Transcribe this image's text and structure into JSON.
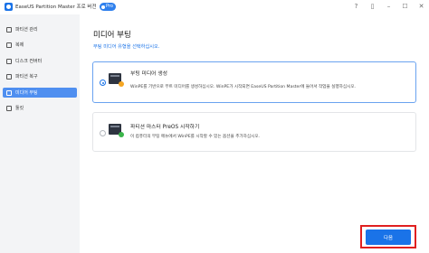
{
  "window": {
    "title": "EaseUS Partition Master 프로 버전",
    "badge": "Pro",
    "controls": [
      "help-icon",
      "bookmark-icon",
      "minimize-icon",
      "maximize-icon",
      "close-icon"
    ]
  },
  "sidebar": {
    "items": [
      {
        "label": "파티션 관리",
        "icon": "partition-icon",
        "active": false
      },
      {
        "label": "복제",
        "icon": "clone-icon",
        "active": false
      },
      {
        "label": "디스크 컨버터",
        "icon": "disk-convert-icon",
        "active": false
      },
      {
        "label": "파티션 복구",
        "icon": "recovery-icon",
        "active": false
      },
      {
        "label": "미디어 부팅",
        "icon": "boot-media-icon",
        "active": true
      },
      {
        "label": "툴킷",
        "icon": "toolkit-icon",
        "active": false
      }
    ]
  },
  "main": {
    "title": "미디어 부팅",
    "subtitle": "부팅 미디어 유형을 선택하십시오.",
    "options": [
      {
        "title": "부팅 미디어 생성",
        "description": "WinPE를 기반으로 부트 미디어를 생성하십시오. WinPE가 시작되면 EaseUS Partition Master에 들어서 작업을 실행하십시오.",
        "selected": true
      },
      {
        "title": "파티션 마스터 PreOS 시작하기",
        "description": "이 컴퓨터의 부팅 메뉴에서 WinPE를 시작할 수 있는 옵션을 추가하십시오.",
        "selected": false
      }
    ],
    "next_label": "다음"
  },
  "colors": {
    "accent": "#1a73e8",
    "highlight": "#e02020",
    "sidebar_bg": "#f3f4f6"
  }
}
